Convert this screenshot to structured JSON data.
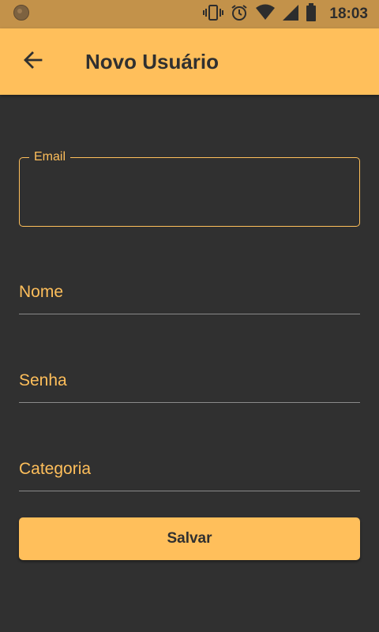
{
  "status_bar": {
    "time": "18:03",
    "icons": [
      "notification-dot-icon",
      "vibrate-icon",
      "alarm-icon",
      "wifi-icon",
      "signal-icon",
      "battery-icon"
    ]
  },
  "app_bar": {
    "title": "Novo Usuário",
    "back_icon": "arrow-back-icon",
    "background": "#ffbf5b"
  },
  "form": {
    "email": {
      "label": "Email",
      "value": ""
    },
    "nome": {
      "label": "Nome",
      "value": ""
    },
    "senha": {
      "label": "Senha",
      "value": ""
    },
    "categoria": {
      "label": "Categoria",
      "value": ""
    },
    "save_label": "Salvar"
  },
  "colors": {
    "accent": "#ffbf5b",
    "background": "#303030",
    "status_bar": "#c3924a",
    "divider": "#8a8a8a"
  }
}
